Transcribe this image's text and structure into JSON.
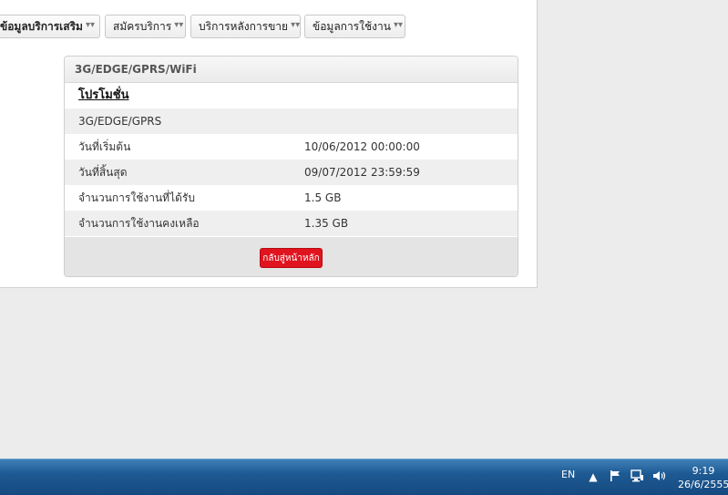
{
  "nav": {
    "tabs": [
      {
        "label": "ข้อมูลบริการเสริม"
      },
      {
        "label": "สมัครบริการ"
      },
      {
        "label": "บริการหลังการขาย"
      },
      {
        "label": "ข้อมูลการใช้งาน"
      }
    ]
  },
  "panel": {
    "header": "3G/EDGE/GPRS/WiFi",
    "promo_title": "โปรโมชั่น",
    "package_name": "3G/EDGE/GPRS",
    "rows": [
      {
        "label": "วันที่เริ่มต้น",
        "value": "10/06/2012 00:00:00"
      },
      {
        "label": "วันที่สิ้นสุด",
        "value": "09/07/2012 23:59:59"
      },
      {
        "label": "จำนวนการใช้งานที่ได้รับ",
        "value": "1.5 GB"
      },
      {
        "label": "จำนวนการใช้งานคงเหลือ",
        "value": "1.35 GB"
      }
    ],
    "home_button": "กลับสู่หน้าหลัก"
  },
  "taskbar": {
    "language": "EN",
    "time": "9:19",
    "date": "26/6/2555"
  },
  "icons": {
    "chevron": "double-chevron-down",
    "tray": [
      "show-hidden-icons",
      "action-center-flag",
      "network",
      "volume"
    ]
  }
}
